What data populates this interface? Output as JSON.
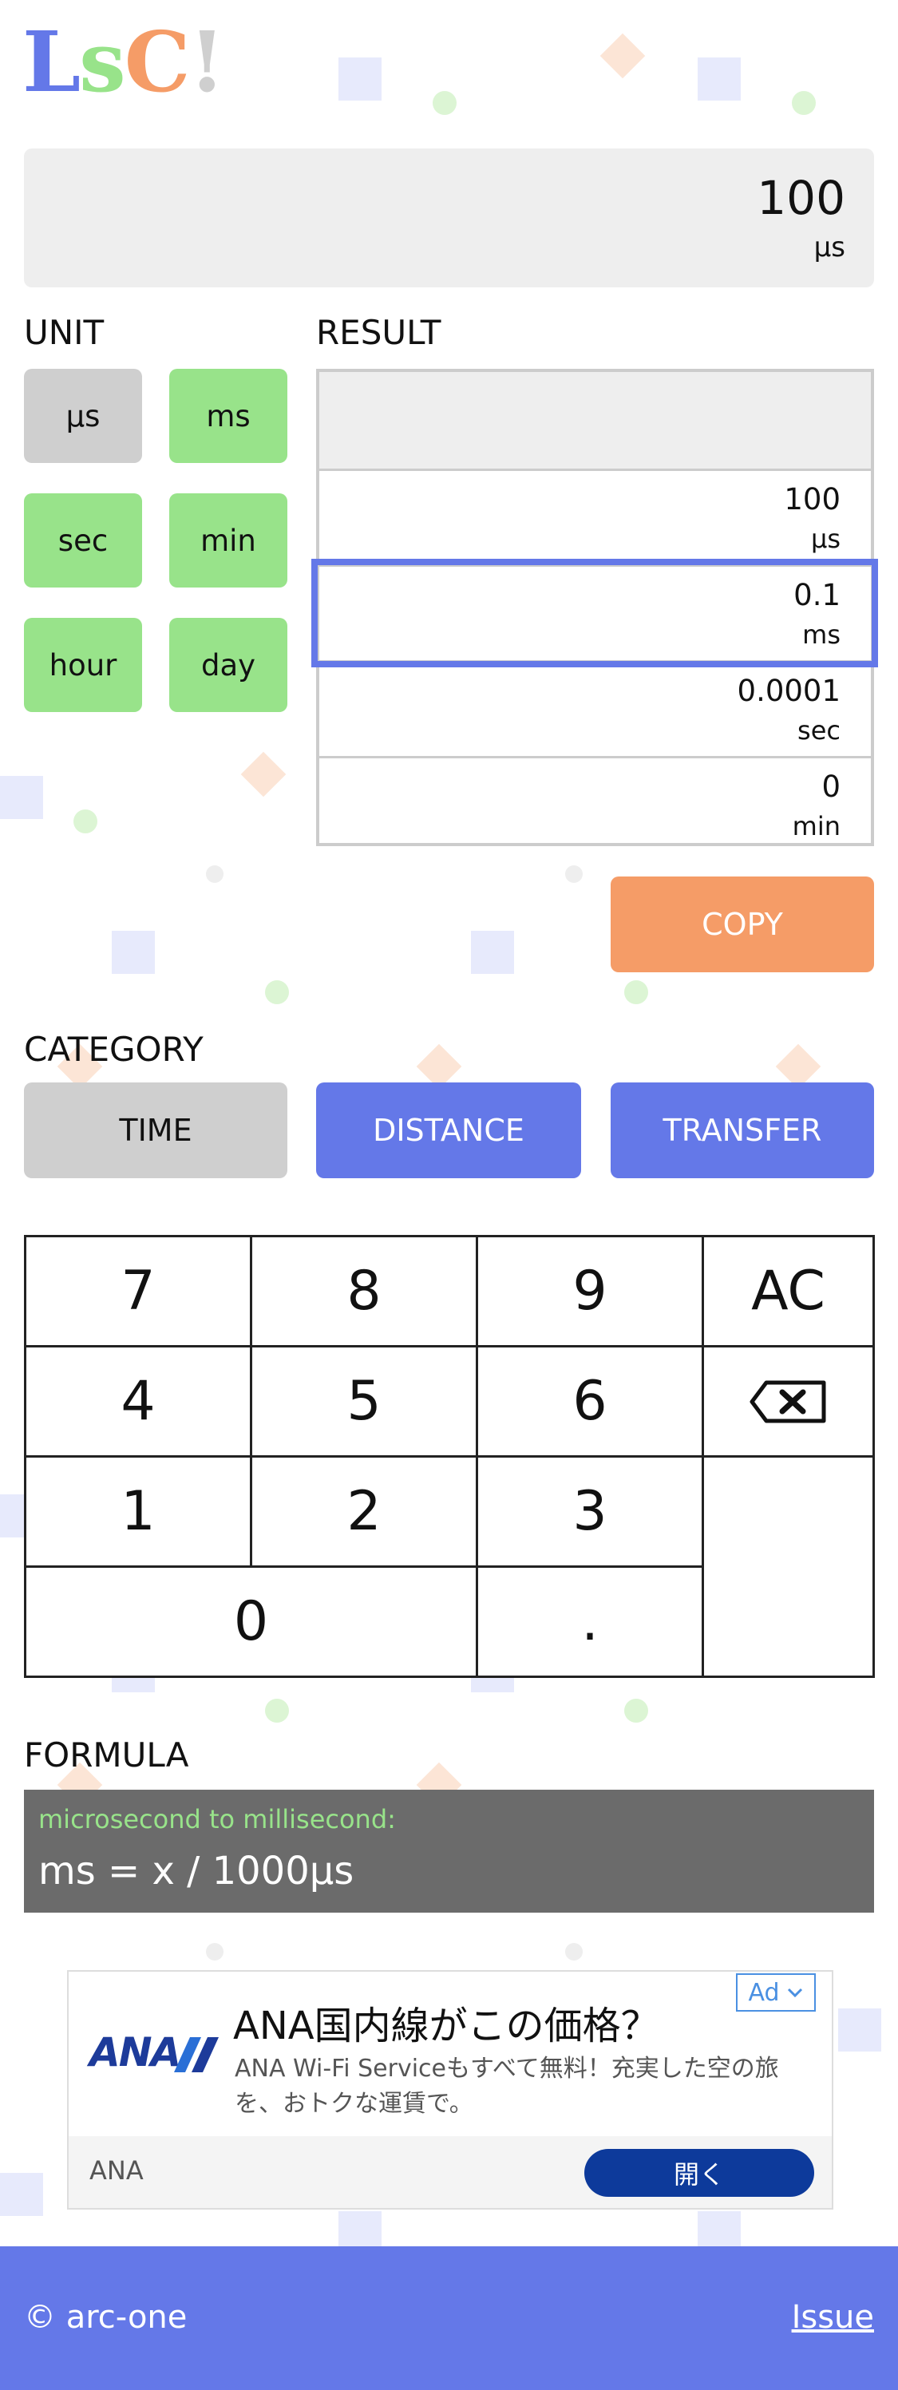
{
  "logo": {
    "l1": "L",
    "l2": "s",
    "l3": "C",
    "l4": "!"
  },
  "colors": {
    "accent_blue": "#6478e8",
    "green": "#98e38a",
    "orange": "#f59c67",
    "gray": "#cfcfcf",
    "formula_bg": "#6b6b6b"
  },
  "display": {
    "value": "100",
    "unit": "µs"
  },
  "unit_section": {
    "label": "UNIT",
    "buttons": [
      "µs",
      "ms",
      "sec",
      "min",
      "hour",
      "day"
    ],
    "selected": "µs"
  },
  "result_section": {
    "label": "RESULT",
    "rows": [
      {
        "value": "100",
        "unit": "µs"
      },
      {
        "value": "0.1",
        "unit": "ms"
      },
      {
        "value": "0.0001",
        "unit": "sec"
      },
      {
        "value": "0",
        "unit": "min"
      }
    ],
    "highlighted": "ms"
  },
  "copy_label": "COPY",
  "category_section": {
    "label": "CATEGORY",
    "buttons": [
      "TIME",
      "DISTANCE",
      "TRANSFER"
    ],
    "selected": "TIME"
  },
  "keypad": {
    "k7": "7",
    "k8": "8",
    "k9": "9",
    "ac": "AC",
    "k4": "4",
    "k5": "5",
    "k6": "6",
    "k1": "1",
    "k2": "2",
    "k3": "3",
    "k0": "0",
    "dot": ".",
    "backspace_icon": "backspace-icon"
  },
  "formula_section": {
    "label": "FORMULA",
    "title": "microsecond to millisecond:",
    "expression": "ms = x / 1000µs"
  },
  "ad": {
    "logo": "ANA",
    "title": "ANA国内線がこの価格？",
    "description": "ANA Wi-Fi Serviceもすべて無料！充実した空の旅を、おトクな運賃で。",
    "badge": "Ad",
    "advertiser": "ANA",
    "cta": "開く"
  },
  "footer": {
    "copyright": "© arc-one",
    "issue": "Issue"
  }
}
